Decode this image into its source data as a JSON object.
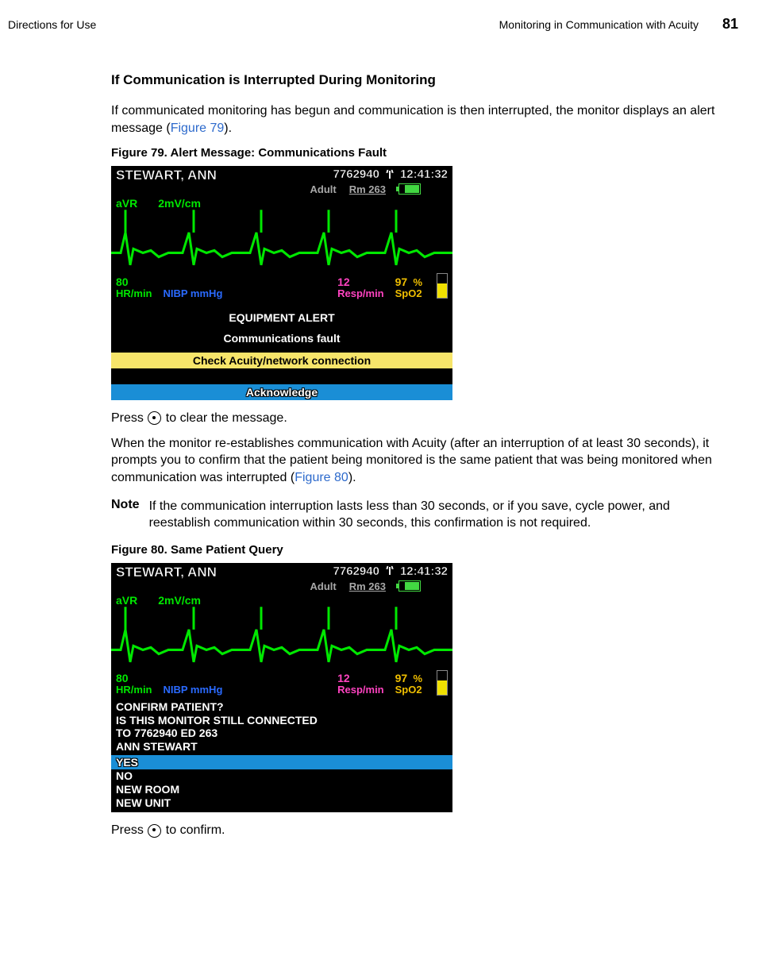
{
  "header": {
    "left": "Directions for Use",
    "rightTitle": "Monitoring in Communication with Acuity",
    "pageNum": "81"
  },
  "section": {
    "subheading": "If Communication is Interrupted During Monitoring",
    "intro_a": "If communicated monitoring has begun and communication is then interrupted, the monitor displays an alert message (",
    "intro_ref1": "Figure 79",
    "intro_b": ").",
    "fig79cap": "Figure 79.  Alert Message: Communications Fault",
    "press1_a": "Press ",
    "press1_b": " to clear the message.",
    "reest_a": "When the monitor re-establishes communication with Acuity (after an interruption of at least 30 seconds), it prompts you to confirm that the patient being monitored is the same patient that was being monitored when communication was interrupted (",
    "reest_ref": "Figure 80",
    "reest_b": ").",
    "note_label": "Note",
    "note_text": "If the communication interruption lasts less than 30 seconds, or if you save, cycle power, and reestablish communication within 30 seconds, this confirmation is not required.",
    "fig80cap": "Figure 80.  Same Patient Query",
    "press2_a": "Press ",
    "press2_b": " to confirm."
  },
  "monitor_common": {
    "patient": "STEWART, ANN",
    "id": "7762940",
    "time": "12:41:32",
    "mode": "Adult",
    "room": "Rm 263",
    "lead": "aVR",
    "gain": "2mV/cm",
    "hr_val": "80",
    "hr_lbl": "HR/min",
    "nibp_lbl": "NIBP mmHg",
    "resp_val": "12",
    "resp_lbl": "Resp/min",
    "spo2_val": "97",
    "spo2_pct": "%",
    "spo2_lbl": "SpO2"
  },
  "fig79": {
    "alert_l1": "EQUIPMENT ALERT",
    "alert_l2": "Communications fault",
    "yellow": "Check Acuity/network connection",
    "ack": "Acknowledge"
  },
  "fig80": {
    "confirm": {
      "l1": "CONFIRM PATIENT?",
      "l2": "IS THIS MONITOR STILL CONNECTED",
      "l3": "TO 7762940 ED 263",
      "l4": "ANN STEWART"
    },
    "yes": "YES",
    "no": "NO",
    "newroom": "NEW ROOM",
    "newunit": "NEW UNIT"
  }
}
